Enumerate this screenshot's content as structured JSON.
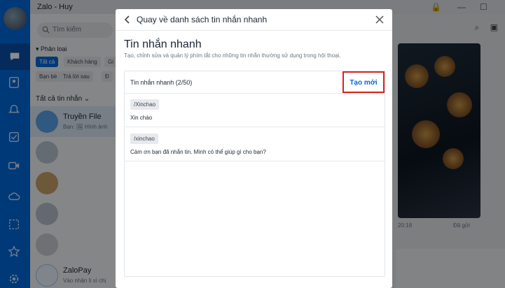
{
  "app": {
    "title": "Zalo - Huy"
  },
  "list": {
    "search_placeholder": "Tìm kiếm",
    "category_label": "Phân loại",
    "chips": [
      "Tất cả",
      "Khách hàng",
      "Gi",
      "Bạn bè",
      "Trả lời sau",
      "Đ"
    ],
    "all_messages_label": "Tất cả tin nhắn",
    "conversations": [
      {
        "name": "Truyền File",
        "preview": "Bạn: 🖼 Hình ảnh"
      },
      {
        "name": "ZaloPay",
        "preview": "Vào nhận lì xì chị"
      }
    ]
  },
  "chat": {
    "time": "20:18",
    "status": "Đã gửi"
  },
  "modal": {
    "header_title": "Quay về danh sách tin nhắn nhanh",
    "title": "Tin nhắn nhanh",
    "description": "Tạo, chỉnh sửa và quản lý phím tắt cho những tin nhắn thường sử dụng trong hội thoại.",
    "count_label": "Tin nhắn nhanh (2/50)",
    "create_label": "Tạo mới",
    "items": [
      {
        "shortcut": "/Xinchao",
        "message": "Xin chào"
      },
      {
        "shortcut": "/xinchao",
        "message": "Cảm ơn bạn đã nhắn tin. Mình có thể giúp gì cho bạn?"
      }
    ]
  },
  "colors": {
    "accent": "#0068d9",
    "highlight_border": "#e0201b"
  }
}
